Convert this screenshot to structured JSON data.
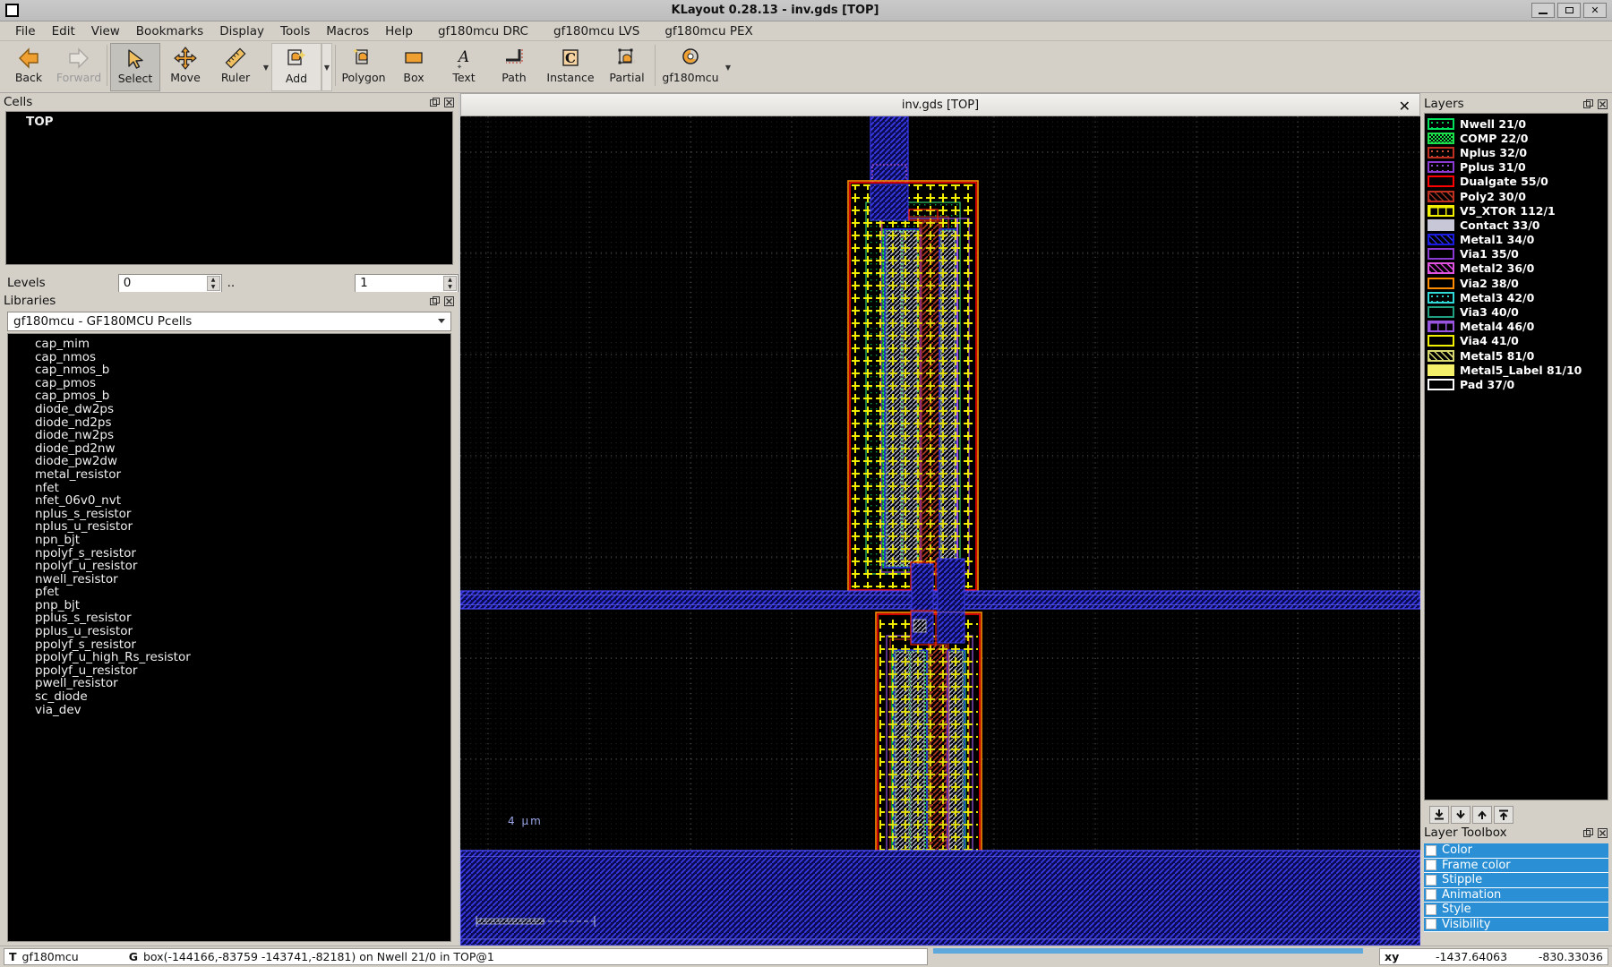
{
  "window": {
    "title": "KLayout 0.28.13 - inv.gds [TOP]",
    "minimize": "minimize",
    "maximize": "maximize",
    "close": "close"
  },
  "menubar": {
    "items": [
      {
        "label": "File"
      },
      {
        "label": "Edit"
      },
      {
        "label": "View"
      },
      {
        "label": "Bookmarks"
      },
      {
        "label": "Display"
      },
      {
        "label": "Tools"
      },
      {
        "label": "Macros"
      },
      {
        "label": "Help"
      },
      {
        "label": "gf180mcu DRC"
      },
      {
        "label": "gf180mcu LVS"
      },
      {
        "label": "gf180mcu PEX"
      }
    ]
  },
  "toolbar": {
    "items": [
      {
        "label": "Back",
        "icon": "arrow-left-icon",
        "enabled": true
      },
      {
        "label": "Forward",
        "icon": "arrow-right-icon",
        "enabled": false
      },
      {
        "label": "Select",
        "icon": "cursor-arrow-icon",
        "selected": true
      },
      {
        "label": "Move",
        "icon": "move-cross-icon"
      },
      {
        "label": "Ruler",
        "icon": "ruler-icon",
        "dropdown": true
      },
      {
        "label": "Add",
        "icon": "add-shape-icon",
        "dropdown": true,
        "framed": true
      },
      {
        "label": "Polygon",
        "icon": "polygon-icon"
      },
      {
        "label": "Box",
        "icon": "box-icon"
      },
      {
        "label": "Text",
        "icon": "text-a-icon"
      },
      {
        "label": "Path",
        "icon": "path-icon"
      },
      {
        "label": "Instance",
        "icon": "instance-c-icon"
      },
      {
        "label": "Partial",
        "icon": "partial-icon"
      },
      {
        "label": "gf180mcu",
        "icon": "gf180mcu-icon",
        "dropdown": true
      }
    ]
  },
  "cells_panel": {
    "title": "Cells",
    "float_icon": "undock-icon",
    "close_icon": "close-icon",
    "items": [
      "TOP"
    ],
    "levels": {
      "label": "Levels",
      "min": "0",
      "separator": "..",
      "max": "1"
    }
  },
  "libraries_panel": {
    "title": "Libraries",
    "float_icon": "undock-icon",
    "close_icon": "close-icon",
    "selected_library": "gf180mcu - GF180MCU Pcells",
    "items": [
      "cap_mim",
      "cap_nmos",
      "cap_nmos_b",
      "cap_pmos",
      "cap_pmos_b",
      "diode_dw2ps",
      "diode_nd2ps",
      "diode_nw2ps",
      "diode_pd2nw",
      "diode_pw2dw",
      "metal_resistor",
      "nfet",
      "nfet_06v0_nvt",
      "nplus_s_resistor",
      "nplus_u_resistor",
      "npn_bjt",
      "npolyf_s_resistor",
      "npolyf_u_resistor",
      "nwell_resistor",
      "pfet",
      "pnp_bjt",
      "pplus_s_resistor",
      "pplus_u_resistor",
      "ppolyf_s_resistor",
      "ppolyf_u_high_Rs_resistor",
      "ppolyf_u_resistor",
      "pwell_resistor",
      "sc_diode",
      "via_dev"
    ]
  },
  "document": {
    "tab_title": "inv.gds [TOP]",
    "close_icon": "close-icon",
    "scale_bar_label": "4 µm"
  },
  "layers_panel": {
    "title": "Layers",
    "float_icon": "undock-icon",
    "close_icon": "close-icon",
    "items": [
      {
        "name": "Nwell 21/0",
        "frame": "#00e05a",
        "fill": "#00e05a",
        "pattern": "dots"
      },
      {
        "name": "COMP 22/0",
        "frame": "#1ae04a",
        "fill": "#1ae04a",
        "pattern": "solidish"
      },
      {
        "name": "Nplus 32/0",
        "frame": "#c03020",
        "fill": "#e05a40",
        "pattern": "dots"
      },
      {
        "name": "Pplus 31/0",
        "frame": "#8a3ad0",
        "fill": "#9a55e0",
        "pattern": "dots"
      },
      {
        "name": "Dualgate 55/0",
        "frame": "#ff0000",
        "fill": "#000000",
        "pattern": "frame"
      },
      {
        "name": "Poly2 30/0",
        "frame": "#c03020",
        "fill": "#a03020",
        "pattern": "diag"
      },
      {
        "name": "V5_XTOR 112/1",
        "frame": "#f0f000",
        "fill": "#000000",
        "pattern": "plus"
      },
      {
        "name": "Contact 33/0",
        "frame": "#c7c7d8",
        "fill": "#c7c7d8",
        "pattern": "solid"
      },
      {
        "name": "Metal1 34/0",
        "frame": "#1a1ae0",
        "fill": "#2a2ae8",
        "pattern": "diag"
      },
      {
        "name": "Via1 35/0",
        "frame": "#8a3ad0",
        "fill": "#000000",
        "pattern": "frame"
      },
      {
        "name": "Metal2 36/0",
        "frame": "#e055e0",
        "fill": "#d040d0",
        "pattern": "diag"
      },
      {
        "name": "Via2 38/0",
        "frame": "#ff8c00",
        "fill": "#000000",
        "pattern": "frame"
      },
      {
        "name": "Metal3 42/0",
        "frame": "#30d8d8",
        "fill": "#30d8d8",
        "pattern": "dots"
      },
      {
        "name": "Via3 40/0",
        "frame": "#20a080",
        "fill": "#000000",
        "pattern": "frame"
      },
      {
        "name": "Metal4 46/0",
        "frame": "#9a55e0",
        "fill": "#000000",
        "pattern": "plus"
      },
      {
        "name": "Via4 41/0",
        "frame": "#f0f000",
        "fill": "#000000",
        "pattern": "frame"
      },
      {
        "name": "Metal5 81/0",
        "frame": "#d8d870",
        "fill": "#d8d870",
        "pattern": "diag"
      },
      {
        "name": "Metal5_Label 81/10",
        "frame": "#f5f06a",
        "fill": "#f5f06a",
        "pattern": "solid"
      },
      {
        "name": "Pad 37/0",
        "frame": "#ffffff",
        "fill": "#000000",
        "pattern": "dots"
      }
    ],
    "buttons": [
      {
        "icon": "move-to-bottom-icon"
      },
      {
        "icon": "move-down-icon"
      },
      {
        "icon": "move-up-icon"
      },
      {
        "icon": "move-to-top-icon"
      }
    ]
  },
  "layer_toolbox": {
    "title": "Layer Toolbox",
    "float_icon": "undock-icon",
    "close_icon": "close-icon",
    "items": [
      "Color",
      "Frame color",
      "Stipple",
      "Animation",
      "Style",
      "Visibility"
    ]
  },
  "statusbar": {
    "tech_key": "T",
    "tech_value": "gf180mcu",
    "geom_key": "G",
    "geom_value": "box(-144166,-83759 -143741,-82181) on Nwell 21/0 in TOP@1",
    "xy_key": "xy",
    "x_value": "-1437.64063",
    "y_value": "-830.33036"
  }
}
